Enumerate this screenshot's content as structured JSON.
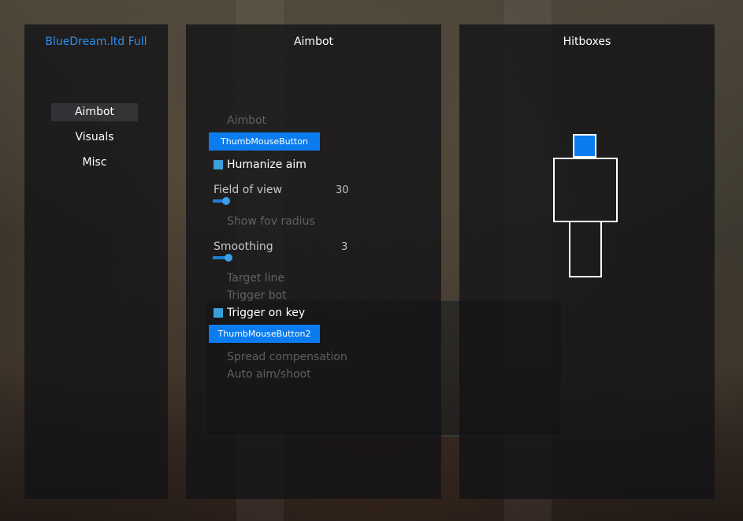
{
  "left_panel": {
    "brand": "BlueDream.ltd Full",
    "nav": [
      {
        "label": "Aimbot",
        "active": true
      },
      {
        "label": "Visuals",
        "active": false
      },
      {
        "label": "Misc",
        "active": false
      }
    ]
  },
  "aimbot_panel": {
    "title": "Aimbot",
    "aimbot_label": "Aimbot",
    "aim_key": "ThumbMouseButton",
    "humanize_label": "Humanize aim",
    "fov_label": "Field of view",
    "fov_value": "30",
    "fov_fraction": 0.1,
    "show_fov_label": "Show fov radius",
    "smoothing_label": "Smoothing",
    "smoothing_value": "3",
    "smoothing_fraction": 0.12,
    "target_line_label": "Target line",
    "trigger_bot_label": "Trigger bot",
    "trigger_on_key_label": "Trigger on key",
    "trigger_key": "ThumbMouseButton2",
    "spread_label": "Spread compensation",
    "auto_aim_label": "Auto aim/shoot"
  },
  "hitbox_panel": {
    "title": "Hitboxes",
    "selected": "head"
  },
  "colors": {
    "accent": "#0a7cf0",
    "brand": "#2d8ff0",
    "checkbox": "#3aa0d8"
  }
}
